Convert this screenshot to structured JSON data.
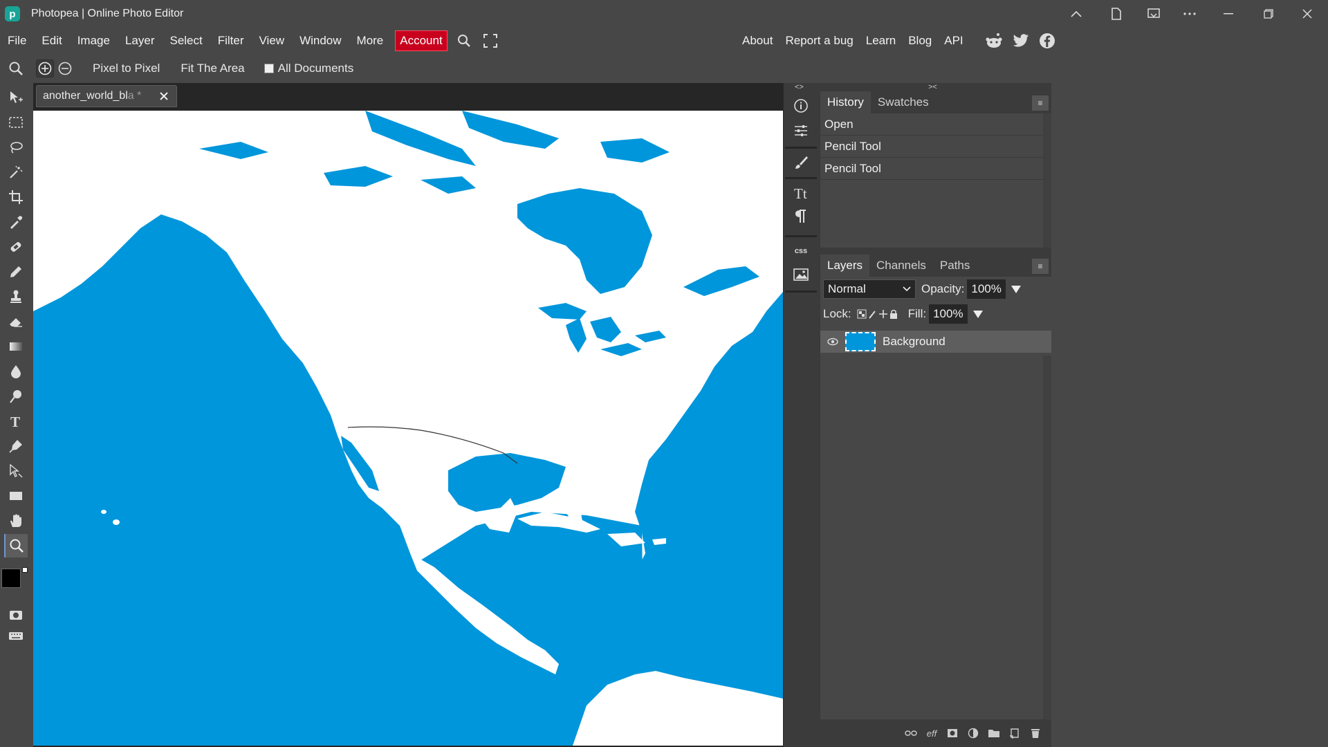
{
  "window": {
    "title": "Photopea | Online Photo Editor",
    "logo_text": "p"
  },
  "menu": {
    "items": [
      "File",
      "Edit",
      "Image",
      "Layer",
      "Select",
      "Filter",
      "View",
      "Window",
      "More"
    ],
    "account": "Account",
    "links": [
      "About",
      "Report a bug",
      "Learn",
      "Blog",
      "API"
    ]
  },
  "options": {
    "pixel_to_pixel": "Pixel to Pixel",
    "fit_area": "Fit The Area",
    "all_documents": "All Documents"
  },
  "document": {
    "tab_title": "another_world_bl",
    "tab_suffix": "a *"
  },
  "history": {
    "tabs": [
      "History",
      "Swatches"
    ],
    "items": [
      "Open",
      "Pencil Tool",
      "Pencil Tool"
    ]
  },
  "layers": {
    "tabs": [
      "Layers",
      "Channels",
      "Paths"
    ],
    "blend_mode": "Normal",
    "opacity_label": "Opacity:",
    "opacity": "100%",
    "lock_label": "Lock:",
    "fill_label": "Fill:",
    "fill": "100%",
    "layer_name": "Background"
  },
  "sidebar_icons": [
    "info-icon",
    "adjustments-icon",
    "brush-icon",
    "character-icon",
    "paragraph-icon",
    "css-icon",
    "image-icon"
  ],
  "sidebar_css_text": "css",
  "colors": {
    "ocean": "#0096db",
    "account_red": "#c8001e",
    "panel": "#474747"
  }
}
